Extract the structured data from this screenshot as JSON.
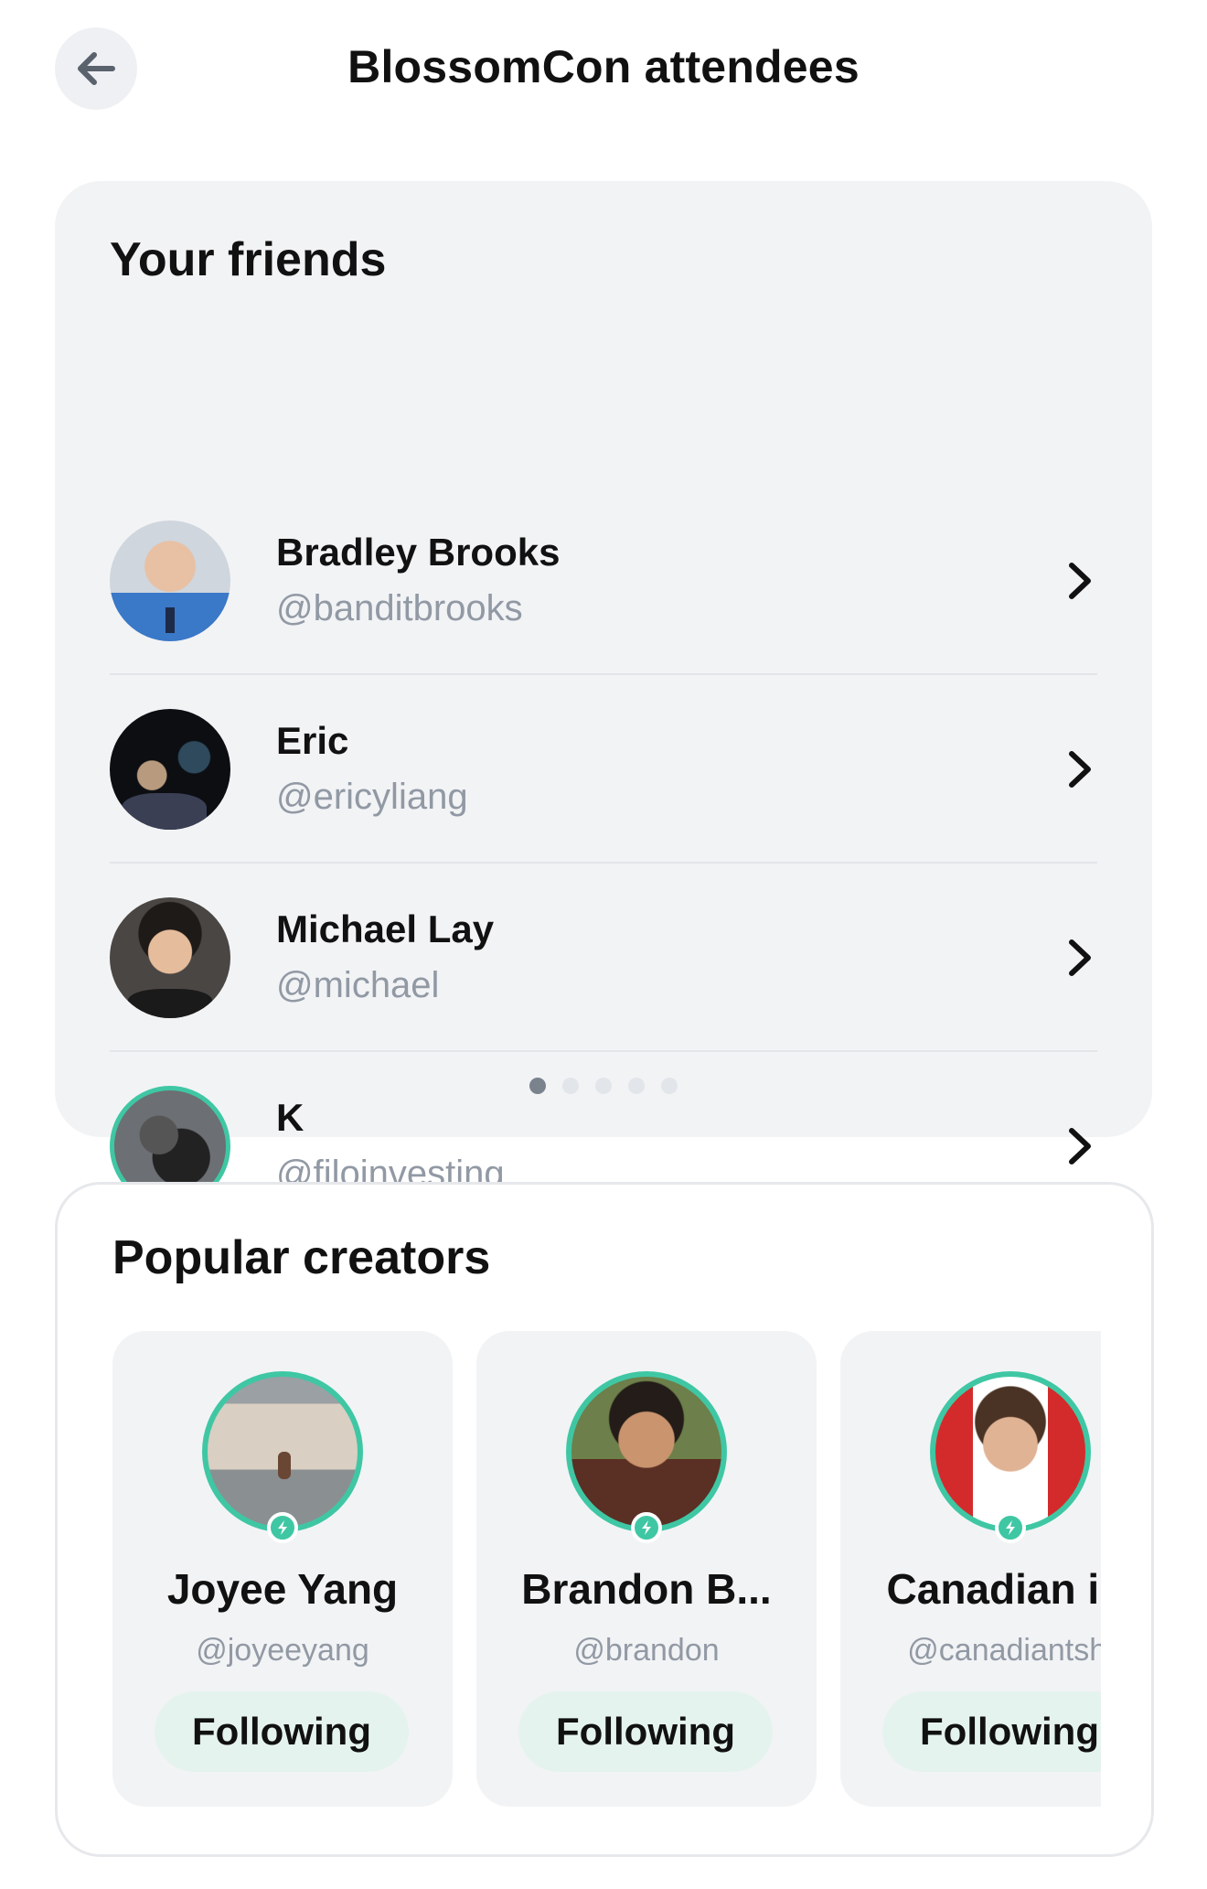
{
  "header": {
    "title": "BlossomCon attendees",
    "back_icon": "arrow-left-icon"
  },
  "friends": {
    "title": "Your friends",
    "items": [
      {
        "name": "Bradley Brooks",
        "handle": "@banditbrooks",
        "verified": false
      },
      {
        "name": "Eric",
        "handle": "@ericyliang",
        "verified": false
      },
      {
        "name": "Michael Lay",
        "handle": "@michael",
        "verified": false
      },
      {
        "name": "K",
        "handle": "@filoinvesting",
        "verified": true
      }
    ],
    "pagination": {
      "pages": 5,
      "current": 1
    }
  },
  "creators": {
    "title": "Popular creators",
    "items": [
      {
        "name": "Joyee Yang",
        "handle": "@joyeeyang",
        "button": "Following",
        "verified": true
      },
      {
        "name": "Brandon B...",
        "handle": "@brandon",
        "button": "Following",
        "verified": true
      },
      {
        "name": "Canadian i...",
        "handle": "@canadiantshi",
        "button": "Following",
        "verified": true
      }
    ]
  },
  "colors": {
    "accent": "#3fc7a4",
    "card_bg": "#f2f3f5",
    "follow_bg": "#e5f3ee",
    "handle_text": "#9199a4"
  }
}
